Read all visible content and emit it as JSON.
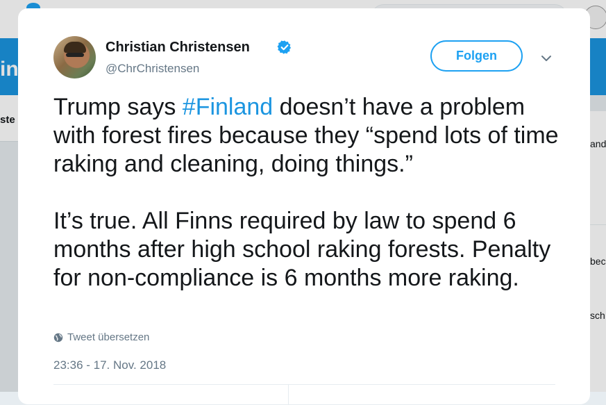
{
  "background": {
    "banner_fragment": "in",
    "left_fragment": "ste",
    "right_fragments": [
      "and",
      "bec",
      "sch"
    ]
  },
  "tweet": {
    "author": {
      "name": "Christian Christensen",
      "handle": "@ChrChristensen",
      "verified": true
    },
    "follow_label": "Folgen",
    "text": {
      "p1_before": "Trump says ",
      "hashtag": "#Finland",
      "p1_after": " doesn’t have a problem with forest fires because they “spend lots of time raking and cleaning, doing things.”",
      "p2": "It’s true. All Finns required by law to spend 6 months after high school raking forests. Penalty for non-compliance is 6 months more raking."
    },
    "translate_label": "Tweet übersetzen",
    "timestamp": "23:36 - 17. Nov. 2018"
  },
  "colors": {
    "accent": "#1da1f2",
    "hashtag": "#1b95e0",
    "text": "#14171a",
    "secondary": "#657786",
    "banner": "#1b95e0",
    "page_bg": "#e6ecf0"
  },
  "icons": {
    "verified": "verified-badge-icon",
    "caret": "chevron-down-icon",
    "translate": "globe-icon"
  }
}
